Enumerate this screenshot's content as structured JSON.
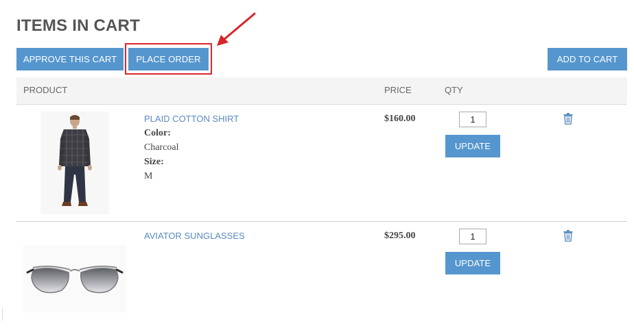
{
  "page": {
    "title": "ITEMS IN CART"
  },
  "toolbar": {
    "approve_label": "APPROVE THIS CART",
    "place_order_label": "PLACE ORDER",
    "add_to_cart_label": "ADD TO CART"
  },
  "table": {
    "headers": {
      "product": "PRODUCT",
      "price": "PRICE",
      "qty": "QTY"
    },
    "items": [
      {
        "name": "PLAID COTTON SHIRT",
        "attributes": [
          {
            "label": "Color:",
            "value": "Charcoal"
          },
          {
            "label": "Size:",
            "value": "M"
          }
        ],
        "price": "$160.00",
        "qty": "1",
        "update_label": "UPDATE"
      },
      {
        "name": "AVIATOR SUNGLASSES",
        "price": "$295.00",
        "qty": "1",
        "update_label": "UPDATE"
      }
    ]
  },
  "colors": {
    "button": "#5596ce",
    "highlight": "#d9242a",
    "link": "#5a8ac0"
  },
  "icons": {
    "delete": "trash-icon",
    "annotation": "arrow-icon"
  }
}
